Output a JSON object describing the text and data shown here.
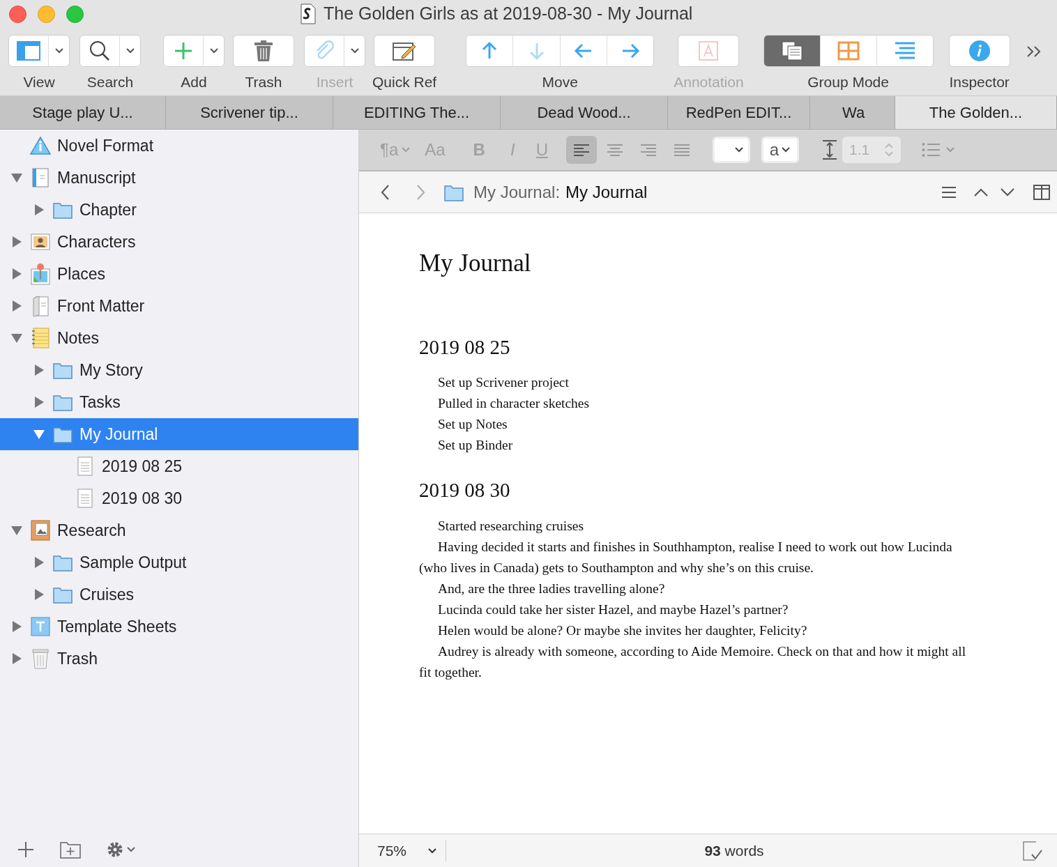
{
  "window": {
    "title": "The Golden Girls as at 2019-08-30 - My Journal"
  },
  "toolbar": [
    {
      "kind": "dropdown",
      "label": "View",
      "disabled": false
    },
    {
      "kind": "dropdown",
      "label": "Search",
      "disabled": false
    },
    {
      "kind": "dropdown",
      "label": "Add",
      "disabled": false
    },
    {
      "kind": "single",
      "label": "Trash",
      "disabled": false
    },
    {
      "kind": "dropdown",
      "label": "Insert",
      "disabled": true
    },
    {
      "kind": "single",
      "label": "Quick Ref",
      "disabled": false
    },
    {
      "kind": "segmented",
      "label": "Move",
      "disabled": false,
      "segments": [
        {
          "disabled": false,
          "selected": false
        },
        {
          "disabled": true,
          "selected": false
        },
        {
          "disabled": false,
          "selected": false
        },
        {
          "disabled": false,
          "selected": false
        }
      ]
    },
    {
      "kind": "single",
      "label": "Annotation",
      "disabled": true
    },
    {
      "kind": "segmented",
      "label": "Group Mode",
      "disabled": false,
      "segments": [
        {
          "disabled": false,
          "selected": true
        },
        {
          "disabled": false,
          "selected": false
        },
        {
          "disabled": false,
          "selected": false
        }
      ]
    },
    {
      "kind": "single",
      "label": "Inspector",
      "disabled": false
    }
  ],
  "tabs": [
    {
      "label": "Stage play U...",
      "selected": false
    },
    {
      "label": "Scrivener tip...",
      "selected": false
    },
    {
      "label": "EDITING The...",
      "selected": false
    },
    {
      "label": "Dead Wood...",
      "selected": false
    },
    {
      "label": "RedPen EDIT...",
      "selected": false
    },
    {
      "label": "Wa",
      "selected": false
    },
    {
      "label": "The Golden...",
      "selected": true
    }
  ],
  "binder": [
    {
      "kind": "info",
      "label": "Novel Format",
      "selected": false
    },
    {
      "kind": "manuscript",
      "label": "Manuscript",
      "expanded": true,
      "selected": false,
      "children": [
        {
          "kind": "folder",
          "label": "Chapter",
          "expanded": false,
          "selected": false
        }
      ]
    },
    {
      "kind": "characters",
      "label": "Characters",
      "expanded": false,
      "selected": false
    },
    {
      "kind": "places",
      "label": "Places",
      "expanded": false,
      "selected": false
    },
    {
      "kind": "frontmatter",
      "label": "Front Matter",
      "expanded": false,
      "selected": false
    },
    {
      "kind": "notes",
      "label": "Notes",
      "expanded": true,
      "selected": false,
      "children": [
        {
          "kind": "folder",
          "label": "My Story",
          "expanded": false,
          "selected": false
        },
        {
          "kind": "folder",
          "label": "Tasks",
          "expanded": false,
          "selected": false
        },
        {
          "kind": "folder",
          "label": "My Journal",
          "expanded": true,
          "selected": true,
          "children": [
            {
              "kind": "document",
              "label": "2019 08 25",
              "selected": false
            },
            {
              "kind": "document",
              "label": "2019 08 30",
              "selected": false
            }
          ]
        }
      ]
    },
    {
      "kind": "research",
      "label": "Research",
      "expanded": true,
      "selected": false,
      "children": [
        {
          "kind": "folder",
          "label": "Sample Output",
          "expanded": false,
          "selected": false
        },
        {
          "kind": "folder",
          "label": "Cruises",
          "expanded": false,
          "selected": false
        }
      ]
    },
    {
      "kind": "template",
      "label": "Template Sheets",
      "expanded": false,
      "selected": false
    },
    {
      "kind": "trash",
      "label": "Trash",
      "expanded": false,
      "selected": false
    }
  ],
  "format_bar": {
    "style": "¶a",
    "font": "Aa",
    "bold": "B",
    "italic": "I",
    "underline": "U",
    "alignments": [
      {
        "selected": true
      },
      {
        "selected": false
      },
      {
        "selected": false
      },
      {
        "selected": false
      }
    ],
    "highlight": "a",
    "line_spacing": "1.1"
  },
  "header": {
    "path": "My Journal:",
    "title": "My Journal"
  },
  "document": [
    {
      "kind": "title",
      "text": "My Journal"
    },
    {
      "kind": "heading",
      "text": "2019 08 25"
    },
    {
      "kind": "para",
      "text": "Set up Scrivener project"
    },
    {
      "kind": "para",
      "text": "Pulled in character sketches"
    },
    {
      "kind": "para",
      "text": "Set up Notes"
    },
    {
      "kind": "para",
      "text": "Set up Binder"
    },
    {
      "kind": "heading",
      "text": "2019 08 30"
    },
    {
      "kind": "para",
      "text": "Started researching cruises"
    },
    {
      "kind": "para",
      "text": "Having decided it starts and finishes in Southhampton, realise I need to work out how Lucinda (who lives in Canada) gets to Southampton and why she’s on this cruise."
    },
    {
      "kind": "para",
      "text": "And, are the three ladies travelling alone?"
    },
    {
      "kind": "para",
      "text": "Lucinda could take her sister Hazel, and maybe Hazel’s partner?"
    },
    {
      "kind": "para",
      "text": "Helen would be alone? Or maybe she invites her daughter, Felicity?"
    },
    {
      "kind": "para",
      "text": "Audrey is already with someone, according to Aide Memoire. Check on that and how it might all fit together."
    }
  ],
  "footer": {
    "zoom": "75%",
    "word_count": "**93** words"
  }
}
